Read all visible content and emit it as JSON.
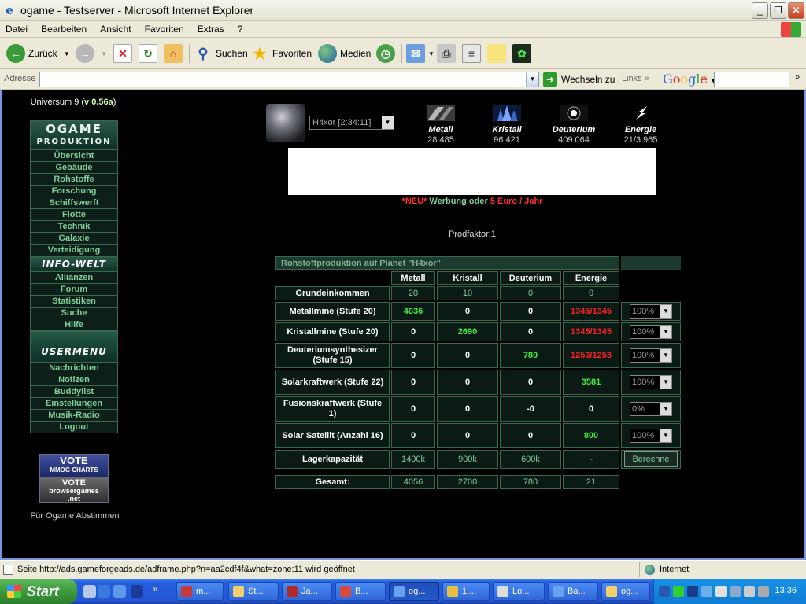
{
  "window": {
    "title": "ogame - Testserver - Microsoft Internet Explorer",
    "minimize": "_",
    "maximize": "❐",
    "close": "✕"
  },
  "menubar": [
    "Datei",
    "Bearbeiten",
    "Ansicht",
    "Favoriten",
    "Extras",
    "?"
  ],
  "toolbar": {
    "back": "Zurück",
    "search": "Suchen",
    "favorites": "Favoriten",
    "media": "Medien"
  },
  "addressbar": {
    "label": "Adresse",
    "url": "",
    "go": "Wechseln zu",
    "links": "Links",
    "google": "Google"
  },
  "sidebar": {
    "universe_prefix": "Universum 9 (",
    "version": "v 0.56a",
    "universe_suffix": ")",
    "logo_top": "OGAME",
    "logo_sub": "PRODUKTION",
    "group1": [
      "Übersicht",
      "Gebäude",
      "Rohstoffe",
      "Forschung",
      "Schiffswerft",
      "Flotte",
      "Technik",
      "Galaxie",
      "Verteidigung"
    ],
    "infowelt": "INFO-WELT",
    "group2": [
      "Allianzen",
      "Forum",
      "Statistiken",
      "Suche",
      "Hilfe"
    ],
    "usermenu": "USERMENU",
    "group3": [
      "Nachrichten",
      "Notizen",
      "Buddylist",
      "Einstellungen",
      "Musik-Radio",
      "Logout"
    ],
    "vote1": "VOTE",
    "vote1_sub": "MMOG CHARTS",
    "vote2": "VOTE",
    "vote2_sub": "browsergames",
    "vote2_sub2": ".net",
    "vote_caption": "Für Ogame Abstimmen"
  },
  "header": {
    "planet_select": "H4xor [2:34:11]",
    "resources": [
      {
        "name": "Metall",
        "value": "28.485"
      },
      {
        "name": "Kristall",
        "value": "96.421"
      },
      {
        "name": "Deuterium",
        "value": "409.064"
      },
      {
        "name": "Energie",
        "value": "21/3.965"
      }
    ],
    "neu": "*NEU*",
    "werbung": " Werbung oder ",
    "price": "5 Euro / Jahr",
    "prodfaktor": "Prodfaktor:1"
  },
  "production": {
    "caption": "Rohstoffproduktion auf Planet \"H4xor\"",
    "columns": [
      "Metall",
      "Kristall",
      "Deuterium",
      "Energie"
    ],
    "grundeinkommen": {
      "label": "Grundeinkommen",
      "values": [
        "20",
        "10",
        "0",
        "0"
      ]
    },
    "rows": [
      {
        "label": "Metallmine (Stufe 20)",
        "values": [
          "4036",
          "0",
          "0",
          "1345/1345"
        ],
        "pct": "100%"
      },
      {
        "label": "Kristallmine (Stufe 20)",
        "values": [
          "0",
          "2690",
          "0",
          "1345/1345"
        ],
        "pct": "100%"
      },
      {
        "label": "Deuteriumsynthesizer (Stufe 15)",
        "values": [
          "0",
          "0",
          "780",
          "1253/1253"
        ],
        "pct": "100%"
      },
      {
        "label": "Solarkraftwerk (Stufe 22)",
        "values": [
          "0",
          "0",
          "0",
          "3581"
        ],
        "pct": "100%"
      },
      {
        "label": "Fusionskraftwerk (Stufe 1)",
        "values": [
          "0",
          "0",
          "-0",
          "0"
        ],
        "pct": "0%"
      },
      {
        "label": "Solar Satellit (Anzahl 16)",
        "values": [
          "0",
          "0",
          "0",
          "800"
        ],
        "pct": "100%"
      }
    ],
    "lager": {
      "label": "Lagerkapazität",
      "values": [
        "1400k",
        "900k",
        "600k",
        "-"
      ],
      "button": "Berechne"
    },
    "gesamt": {
      "label": "Gesamt:",
      "values": [
        "4056",
        "2700",
        "780",
        "21"
      ]
    }
  },
  "statusbar": {
    "text": "Seite http://ads.gameforgeads.de/adframe.php?n=aa2cdf4f&what=zone:11 wird geöffnet",
    "zone": "Internet"
  },
  "taskbar": {
    "start": "Start",
    "tasks": [
      "m...",
      "St...",
      "Ja...",
      "B...",
      "og...",
      "1....",
      "Lo...",
      "Ba...",
      "og..."
    ],
    "clock": "13:36"
  }
}
